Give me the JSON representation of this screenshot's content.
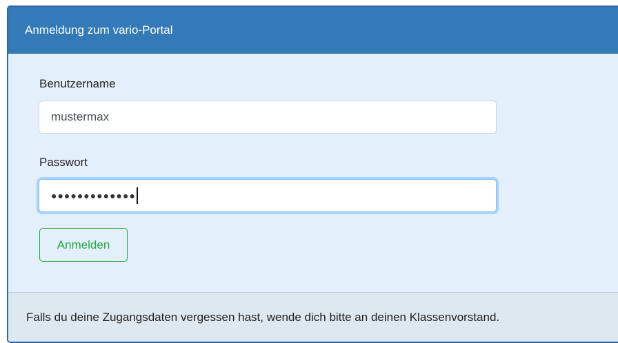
{
  "panel": {
    "title": "Anmeldung zum vario-Portal"
  },
  "form": {
    "username_label": "Benutzername",
    "username_value": "mustermax",
    "password_label": "Passwort",
    "password_masked": "●●●●●●●●●●●●●",
    "submit_label": "Anmelden"
  },
  "footer": {
    "text": "Falls du deine Zugangsdaten vergessen hast, wende dich bitte an deinen Klassenvorstand."
  },
  "colors": {
    "header": "#337ab7",
    "body": "#e3f0fb",
    "button": "#28a745",
    "focus": "#80bdff"
  }
}
